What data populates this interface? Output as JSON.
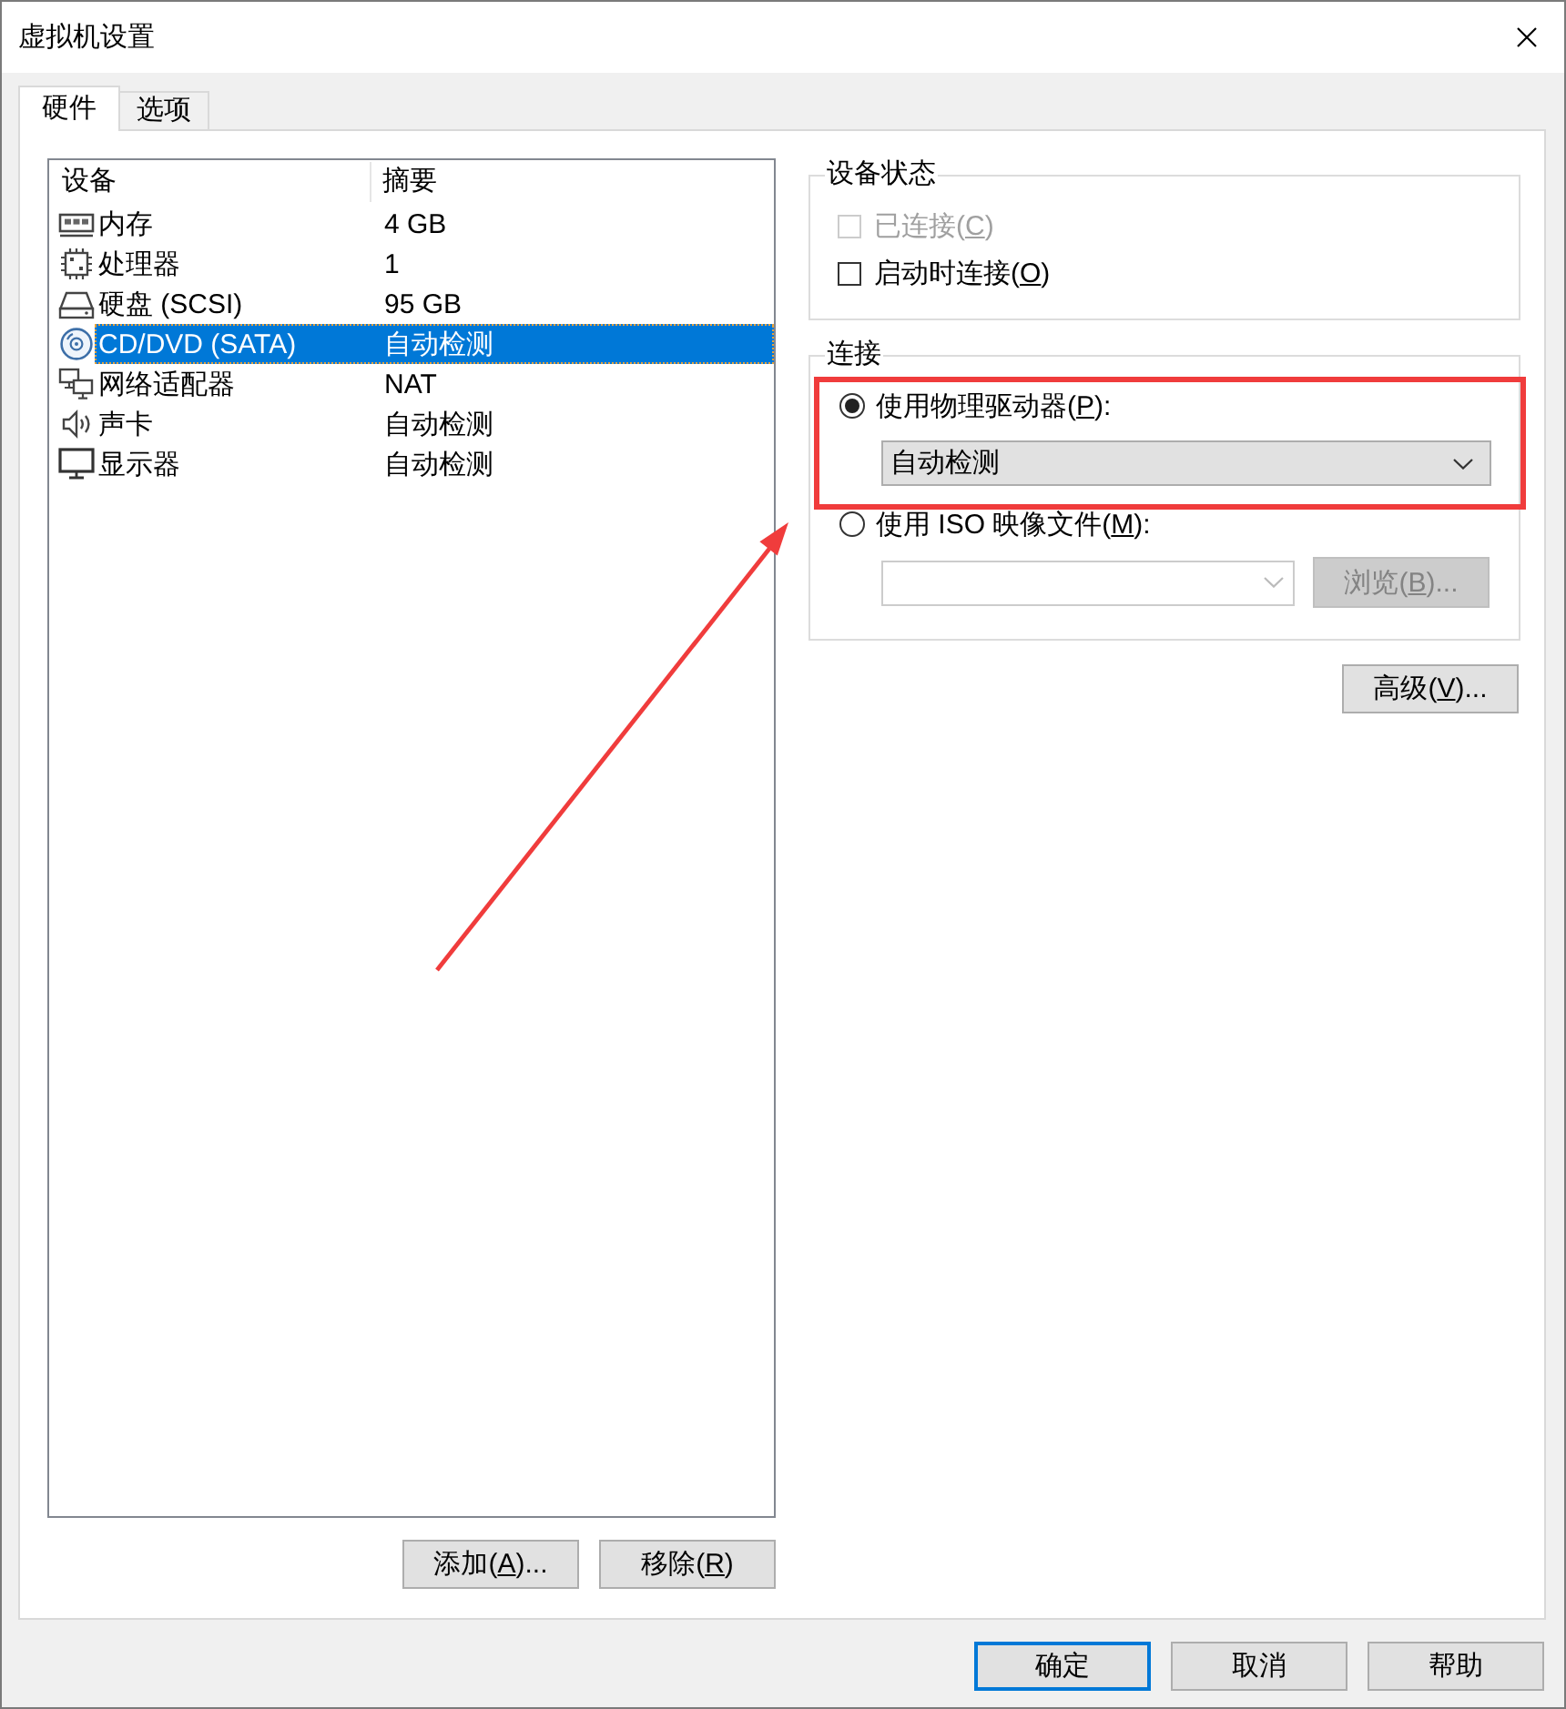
{
  "window": {
    "title": "虚拟机设置"
  },
  "tabs": [
    {
      "label": "硬件",
      "selected": true
    },
    {
      "label": "选项",
      "selected": false
    }
  ],
  "device_list": {
    "columns": [
      "设备",
      "摘要"
    ],
    "rows": [
      {
        "kind": "memory",
        "name": "内存",
        "summary": "4 GB",
        "selected": false
      },
      {
        "kind": "cpu",
        "name": "处理器",
        "summary": "1",
        "selected": false
      },
      {
        "kind": "disk",
        "name": "硬盘 (SCSI)",
        "summary": "95 GB",
        "selected": false
      },
      {
        "kind": "optical",
        "name": "CD/DVD (SATA)",
        "summary": "自动检测",
        "selected": true
      },
      {
        "kind": "network",
        "name": "网络适配器",
        "summary": "NAT",
        "selected": false
      },
      {
        "kind": "sound",
        "name": "声卡",
        "summary": "自动检测",
        "selected": false
      },
      {
        "kind": "display",
        "name": "显示器",
        "summary": "自动检测",
        "selected": false
      }
    ]
  },
  "list_buttons": [
    {
      "label": "添加(",
      "access_key": "A",
      "label_end": ")..."
    },
    {
      "label": "移除(",
      "access_key": "R",
      "label_end": ")"
    }
  ],
  "device_status": {
    "title": "设备状态",
    "options": [
      {
        "label": "已连接(",
        "access_key": "C",
        "label_end": ")",
        "checked": false,
        "disabled": true
      },
      {
        "label": "启动时连接(",
        "access_key": "O",
        "label_end": ")",
        "checked": false,
        "disabled": false
      }
    ]
  },
  "connection": {
    "title": "连接",
    "options": [
      {
        "kind": "physical_drive",
        "label": "使用物理驱动器(",
        "access_key": "P",
        "label_end": "):",
        "selected": true,
        "dropdown": {
          "value": "自动检测",
          "disabled": false
        }
      },
      {
        "kind": "iso_image",
        "label": "使用 ISO 映像文件(",
        "access_key": "M",
        "label_end": "):",
        "selected": false,
        "path_field": {
          "disabled": true
        },
        "browse_button": {
          "label": "浏览(",
          "access_key": "B",
          "label_end": ")...",
          "disabled": true
        }
      }
    ]
  },
  "advanced_button": {
    "label": "高级(",
    "access_key": "V",
    "label_end": ")..."
  },
  "dialog_buttons": [
    {
      "label": "确定",
      "default": true
    },
    {
      "label": "取消",
      "default": false
    },
    {
      "label": "帮助",
      "default": false
    }
  ]
}
